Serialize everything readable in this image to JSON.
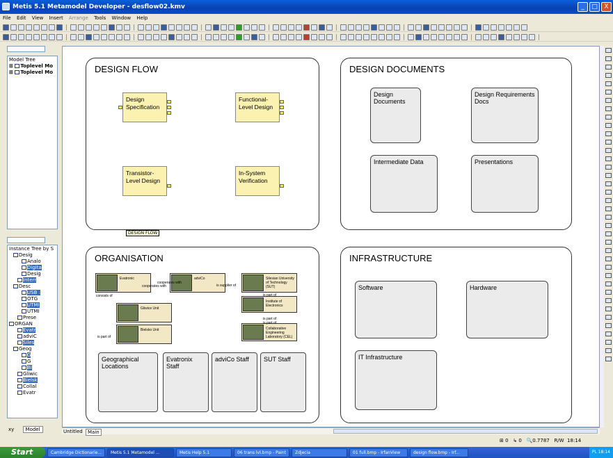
{
  "window": {
    "title": "Metis 5.1 Metamodel Developer - desflow02.kmv",
    "min": "_",
    "max": "□",
    "close": "X"
  },
  "menu": [
    "File",
    "Edit",
    "View",
    "Insert",
    "Arrange",
    "Tools",
    "Window",
    "Help"
  ],
  "left": {
    "model_tree_title": "Model Tree",
    "model_tree": [
      "Toplevel Mo",
      "Toplevel Mo"
    ],
    "instance_tree_title": "Instance Tree by S",
    "instances": [
      {
        "label": "Desig",
        "indent": 1,
        "sel": false
      },
      {
        "label": "Analo",
        "indent": 3,
        "sel": false
      },
      {
        "label": "Digita",
        "indent": 3,
        "sel": true
      },
      {
        "label": "Desig",
        "indent": 3,
        "sel": false
      },
      {
        "label": "Interr",
        "indent": 2,
        "sel": true
      },
      {
        "label": "Desc",
        "indent": 1,
        "sel": false
      },
      {
        "label": "USB :",
        "indent": 3,
        "sel": true
      },
      {
        "label": "OTG",
        "indent": 3,
        "sel": false
      },
      {
        "label": "UTMI",
        "indent": 3,
        "sel": true
      },
      {
        "label": "UTMI",
        "indent": 3,
        "sel": false
      },
      {
        "label": "Prese",
        "indent": 2,
        "sel": false
      },
      {
        "label": "ORGAN",
        "indent": 0,
        "sel": false
      },
      {
        "label": "Evatr",
        "indent": 2,
        "sel": true
      },
      {
        "label": "adviC",
        "indent": 2,
        "sel": false
      },
      {
        "label": "Siles",
        "indent": 2,
        "sel": true
      },
      {
        "label": "Geog",
        "indent": 1,
        "sel": false
      },
      {
        "label": "G",
        "indent": 3,
        "sel": true
      },
      {
        "label": "G",
        "indent": 3,
        "sel": false
      },
      {
        "label": "Bi",
        "indent": 3,
        "sel": true
      },
      {
        "label": "Gliwic",
        "indent": 2,
        "sel": false
      },
      {
        "label": "Bielsk",
        "indent": 2,
        "sel": true
      },
      {
        "label": "Collal",
        "indent": 2,
        "sel": false
      },
      {
        "label": "Evatr",
        "indent": 2,
        "sel": false
      }
    ],
    "tabs": [
      "xy",
      "Model"
    ]
  },
  "canvas": {
    "design_flow": {
      "title": "DESIGN FLOW",
      "tooltip": "DESIGN FLOW",
      "items": [
        "Design Specification",
        "Functional-Level Design",
        "Transistor-Level Design",
        "In-System Verification"
      ]
    },
    "design_docs": {
      "title": "DESIGN DOCUMENTS",
      "items": [
        "Design Documents",
        "Design Requirements Docs",
        "Intermediate Data",
        "Presentations"
      ]
    },
    "organisation": {
      "title": "ORGANISATION",
      "units": [
        "Evatronic",
        "adviCo",
        "Silesian University of Technology (SUT)",
        "Institute of Electronics",
        "Collaborative Engineering Laboratory (CEL)",
        "Gliwice Unit",
        "Bielsko Unit"
      ],
      "rel": [
        "cooperates with",
        "cooperates with",
        "is supplier of",
        "consists of",
        "is part of",
        "is part of",
        "is part of",
        "is part of"
      ],
      "groups": [
        "Geographical Locations",
        "Evatronix Staff",
        "adviCo Staff",
        "SUT Staff"
      ]
    },
    "infrastructure": {
      "title": "INFRASTRUCTURE",
      "items": [
        "Software",
        "Hardware",
        "IT Infrastructure"
      ]
    }
  },
  "sheet_tabs": [
    "Untitled",
    "Main"
  ],
  "status": {
    "a": "0",
    "b": "0",
    "zoom": "0.7787",
    "mode": "R/W",
    "time": "18:14"
  },
  "taskbar": {
    "start": "Start",
    "tasks": [
      "Cambridge Dictionarie...",
      "Metis 5.1 Metamodel ...",
      "Metis Help 5.1",
      "06 trans lvl.bmp - Paint",
      "Zdjecia",
      "01 full.bmp - IrfanView",
      "design flow.bmp - Irf..."
    ],
    "lang": "PL",
    "clock": "18:14"
  }
}
